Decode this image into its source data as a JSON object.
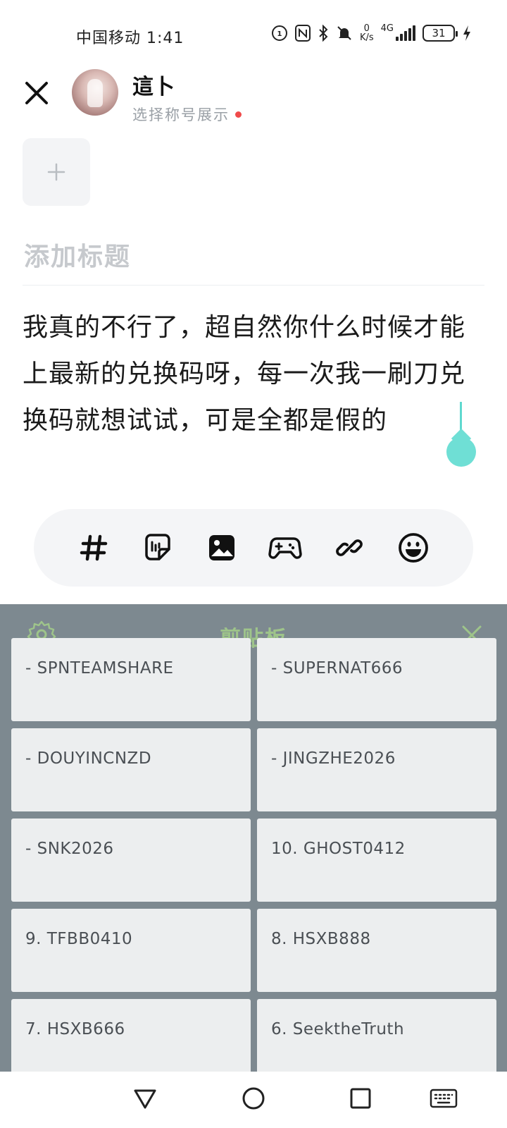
{
  "status_bar": {
    "carrier_time": "中国移动 1:41",
    "net_speed_value": "0",
    "net_speed_unit": "K/s",
    "network": "4G",
    "battery": "31"
  },
  "header": {
    "user_name": "這卜",
    "user_subtitle": "选择称号展示"
  },
  "editor": {
    "add_image_symbol": "+",
    "title_placeholder": "添加标题",
    "body_text": "我真的不行了，超自然你什么时候才能上最新的兑换码呀，每一次我一刷刀兑换码就想试试，可是全都是假的"
  },
  "toolbar": {
    "tools": [
      "hashtag-icon",
      "sticker-icon",
      "image-icon",
      "game-icon",
      "link-icon",
      "emoji-icon"
    ]
  },
  "clipboard": {
    "title": "剪贴板",
    "items": [
      "- SPNTEAMSHARE",
      "- SUPERNAT666",
      "- DOUYINCNZD",
      "- JINGZHE2026",
      "- SNK2026",
      "10. GHOST0412",
      "9. TFBB0410",
      "8. HSXB888",
      "7. HSXB666",
      "6. SeektheTruth"
    ]
  },
  "colors": {
    "accent_teal": "#6fdfd5",
    "clipboard_bg": "#7d8990",
    "clipboard_accent": "#9ec48a"
  }
}
